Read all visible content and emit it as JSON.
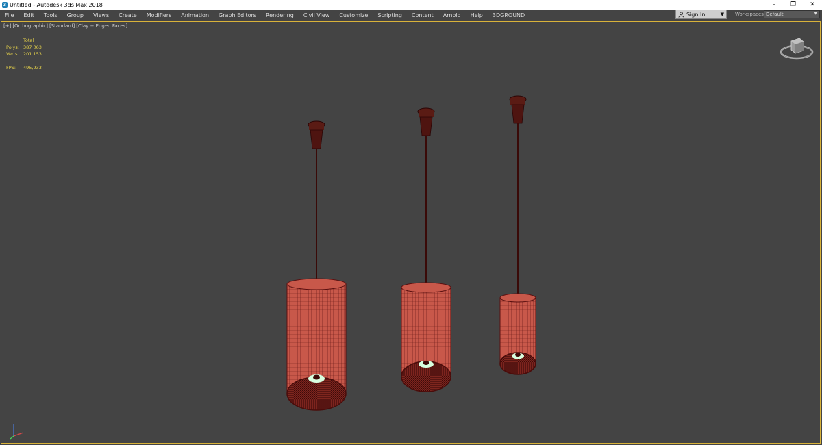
{
  "window": {
    "title": "Untitled - Autodesk 3ds Max 2018",
    "app_icon": "3ds-max-icon",
    "controls": [
      "–",
      "❐",
      "✕"
    ]
  },
  "menu": [
    "File",
    "Edit",
    "Tools",
    "Group",
    "Views",
    "Create",
    "Modifiers",
    "Animation",
    "Graph Editors",
    "Rendering",
    "Civil View",
    "Customize",
    "Scripting",
    "Content",
    "Arnold",
    "Help",
    "3DGROUND"
  ],
  "signin": {
    "label": "Sign In",
    "icon": "user-icon"
  },
  "workspaces": {
    "label": "Workspaces:",
    "value": "Default"
  },
  "viewport": {
    "labels": [
      "[+]",
      "[Orthographic]",
      "[Standard]",
      "[Clay + Edged Faces]"
    ],
    "stats": {
      "header": "Total",
      "polys_label": "Polys:",
      "polys": "387 063",
      "verts_label": "Verts:",
      "verts": "201 153",
      "fps_label": "FPS:",
      "fps": "495,933"
    },
    "border_color": "#d8b23a"
  },
  "colors": {
    "lamp_fill": "#c8584a",
    "lamp_wire": "#5a1010",
    "background": "#444444",
    "stats_text": "#e8d44a"
  },
  "scene_objects": [
    "pendant-lamp-1",
    "pendant-lamp-2",
    "pendant-lamp-3"
  ]
}
